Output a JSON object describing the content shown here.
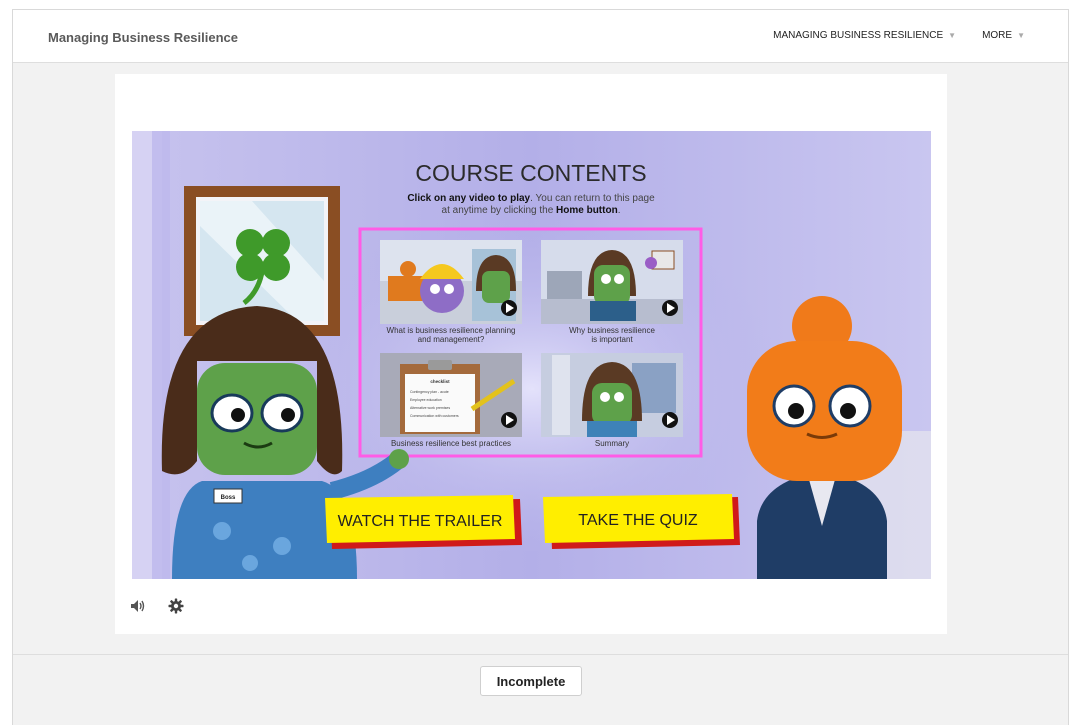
{
  "header": {
    "title": "Managing Business Resilience",
    "nav": [
      {
        "label": "MANAGING BUSINESS RESILIENCE"
      },
      {
        "label": "MORE"
      }
    ]
  },
  "slide": {
    "heading": "COURSE CONTENTS",
    "instruction_bold": "Click on any video to play",
    "instruction_rest": ". You can return to this page",
    "instruction_line2_pre": "at anytime by clicking the ",
    "instruction_line2_bold": "Home button",
    "instruction_line2_post": ".",
    "videos": [
      {
        "caption_line1": "What is business resilience planning",
        "caption_line2": "and management?"
      },
      {
        "caption_line1": "Why business resilience",
        "caption_line2": "is important"
      },
      {
        "caption_line1": "Business resilience best practices",
        "caption_line2": ""
      },
      {
        "caption_line1": "Summary",
        "caption_line2": ""
      }
    ],
    "checklist_title": "checklist",
    "checklist_items": [
      "Contingency plan - acute",
      "Employee education",
      "Alternative work premises",
      "Communication with customers"
    ],
    "badge_text": "Boss",
    "trailer_label": "WATCH THE TRAILER",
    "quiz_label": "TAKE THE QUIZ"
  },
  "controls": {
    "volume_icon": "volume-icon",
    "settings_icon": "gear-icon"
  },
  "footer": {
    "status_label": "Incomplete"
  },
  "colors": {
    "highlight": "#ff5ce6",
    "button_yellow": "#ffee00",
    "button_shadow": "#d01a1a",
    "slide_bg": "#b9b5ea"
  }
}
